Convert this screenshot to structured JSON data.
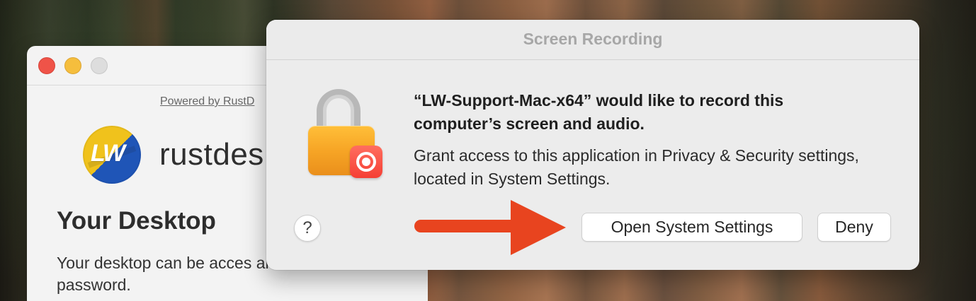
{
  "dialog": {
    "title": "Screen Recording",
    "prompt": "“LW-Support-Mac-x64” would like to record this computer’s screen and audio.",
    "details": "Grant access to this application in Privacy & Security settings, located in System Settings.",
    "help_label": "?",
    "primary_button": "Open System Settings",
    "secondary_button": "Deny"
  },
  "background_app": {
    "powered_by": "Powered by RustD",
    "brand_text": "rustdes",
    "logo_text": "LW",
    "section_title": "Your Desktop",
    "description": "Your desktop can be acces and password."
  },
  "colors": {
    "arrow": "#e8441f",
    "lock": "#f7a626",
    "record_badge": "#f53f34"
  },
  "icons": {
    "lock": "lock-icon",
    "record": "record-icon",
    "help": "help-icon",
    "arrow": "right-arrow-icon"
  }
}
